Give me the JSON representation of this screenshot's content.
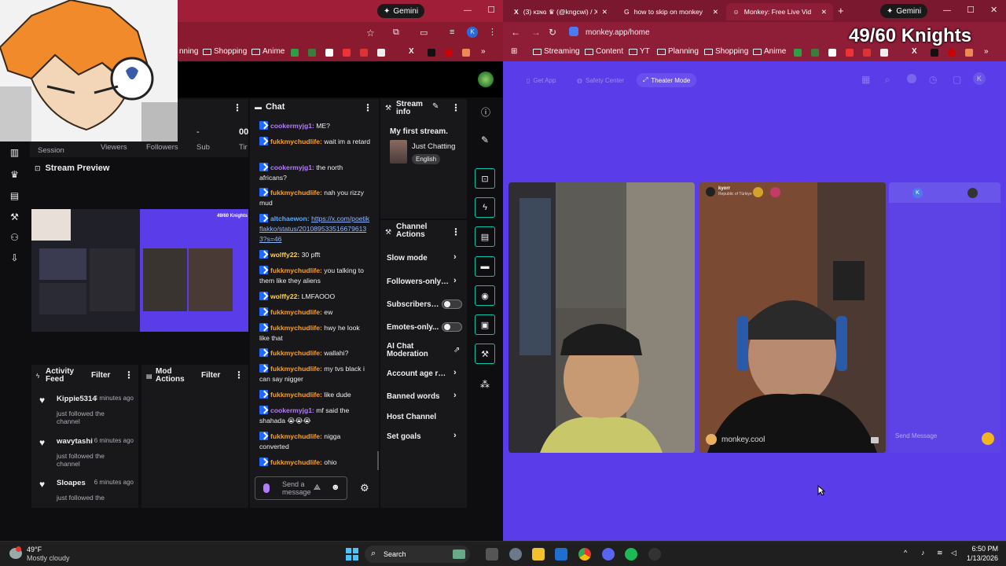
{
  "left_browser": {
    "gemini_label": "Gemini",
    "bookmarks": [
      "nning",
      "Shopping",
      "Anime"
    ]
  },
  "stats": {
    "session_value": "-",
    "viewers_value": "00",
    "labels": [
      "Session",
      "Viewers",
      "Followers",
      "Sub",
      "Tir"
    ]
  },
  "stream_preview": {
    "title": "Stream Preview",
    "overlay_text": "49/60 Knights"
  },
  "chat": {
    "title": "Chat",
    "messages": [
      {
        "user": "cookermyjg1:",
        "text": " ME?",
        "color": "purple"
      },
      {
        "user": "fukkmychudlife:",
        "text": " wait im a retard",
        "color": "orange"
      },
      {
        "user": "cookermyjg1:",
        "text": " the north africans?",
        "color": "purple"
      },
      {
        "user": "fukkmychudlife:",
        "text": " nah you rizzy mud",
        "color": "orange"
      },
      {
        "user": "altchaewon:",
        "text": "https://x.com/poetikflakko/status/2010895335166796133?s=46",
        "color": "blue",
        "link": true
      },
      {
        "user": "wolffy22:",
        "text": " 30 pfft",
        "color": "yellow"
      },
      {
        "user": "fukkmychudlife:",
        "text": " you talking to them like they aliens",
        "color": "orange"
      },
      {
        "user": "wolffy22:",
        "text": " LMFAOOO",
        "color": "yellow"
      },
      {
        "user": "fukkmychudlife:",
        "text": " ew",
        "color": "orange"
      },
      {
        "user": "fukkmychudlife:",
        "text": " hwy he look like that",
        "color": "orange"
      },
      {
        "user": "fukkmychudlife:",
        "text": " wallahi?",
        "color": "orange"
      },
      {
        "user": "fukkmychudlife:",
        "text": " my tvs black i can say nigger",
        "color": "orange"
      },
      {
        "user": "fukkmychudlife:",
        "text": " like dude",
        "color": "orange"
      },
      {
        "user": "cookermyjg1:",
        "text": " mf said the shahada 😭😭😭",
        "color": "purple"
      },
      {
        "user": "fukkmychudlife:",
        "text": " nigga converted",
        "color": "orange"
      },
      {
        "user": "fukkmychudlife:",
        "text": " ohio",
        "color": "orange"
      }
    ],
    "input_placeholder": "Send a message"
  },
  "stream_info": {
    "title": "Stream info",
    "stream_title": "My first stream.",
    "category": "Just Chatting",
    "language": "English"
  },
  "channel_actions": {
    "title": "Channel Actions",
    "items": [
      {
        "label": "Slow mode",
        "control": "chevron"
      },
      {
        "label": "Followers-only ch",
        "control": "chevron"
      },
      {
        "label": "Subscribers-...",
        "control": "toggle"
      },
      {
        "label": "Emotes-only...",
        "control": "toggle"
      },
      {
        "label": "AI Chat Moderation",
        "control": "external"
      },
      {
        "label": "Account age restr",
        "control": "chevron"
      },
      {
        "label": "Banned words",
        "control": "chevron"
      },
      {
        "label": "Host Channel",
        "control": "none"
      },
      {
        "label": "Set goals",
        "control": "chevron"
      }
    ]
  },
  "activity_feed": {
    "title": "Activity Feed",
    "filter_label": "Filter",
    "items": [
      {
        "user": "Kippie5314",
        "ago": "4 minutes ago",
        "action": "just followed the channel"
      },
      {
        "user": "wavytashi",
        "ago": "6 minutes ago",
        "action": "just followed the channel"
      },
      {
        "user": "Sloapes",
        "ago": "6 minutes ago",
        "action": "just followed the channel"
      }
    ]
  },
  "mod_actions": {
    "title": "Mod Actions",
    "filter_label": "Filter"
  },
  "right_browser": {
    "tabs": [
      {
        "label": "(3) ᴋɪɴɢ ♛ (@kngcwi) / X",
        "active": false
      },
      {
        "label": "how to skip on monkey",
        "active": false
      },
      {
        "label": "Monkey: Free Live Vid",
        "active": true
      }
    ],
    "gemini_label": "Gemini",
    "url": "monkey.app/home",
    "bookmarks": [
      "Streaming",
      "Content",
      "YT",
      "Planning",
      "Shopping",
      "Anime"
    ],
    "overlay_counter": "49/60 Knights"
  },
  "monkey": {
    "nav": [
      "Get App",
      "Safety Center",
      "Theater Mode"
    ],
    "partner_name": "kyorr",
    "partner_country": "Republic of Türkiye",
    "watermark": "monkey.cool",
    "send_placeholder": "Send Message",
    "avatar_letter": "K"
  },
  "taskbar": {
    "weather_temp": "49°F",
    "weather_desc": "Mostly cloudy",
    "search_label": "Search",
    "time": "6:50 PM",
    "date": "1/13/2026"
  },
  "colors": {
    "twitch_panel": "#18181b",
    "accent_teal": "#00c8af",
    "monkey_purple": "#5a3de8",
    "browser_red": "#8e1d38"
  }
}
